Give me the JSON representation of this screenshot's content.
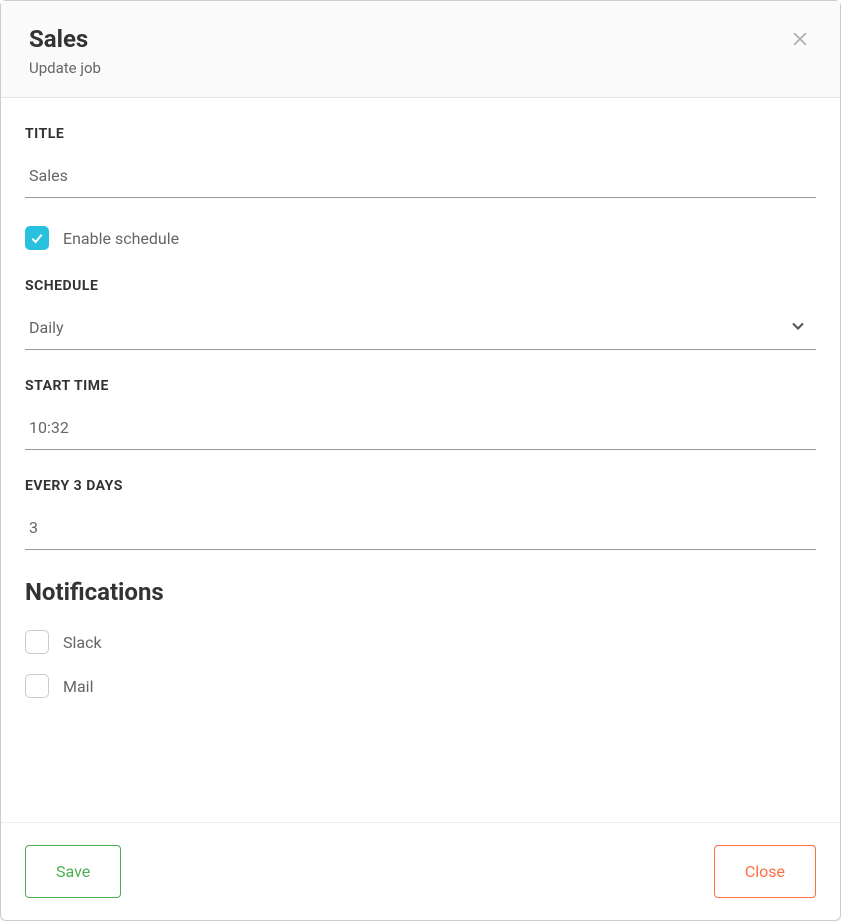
{
  "header": {
    "title": "Sales",
    "subtitle": "Update job"
  },
  "form": {
    "title_label": "TITLE",
    "title_value": "Sales",
    "enable_schedule_label": "Enable schedule",
    "enable_schedule_checked": true,
    "schedule_label": "SCHEDULE",
    "schedule_value": "Daily",
    "start_time_label": "START TIME",
    "start_time_value": "10:32",
    "every_label": "EVERY 3 DAYS",
    "every_value": "3"
  },
  "notifications": {
    "heading": "Notifications",
    "slack_label": "Slack",
    "slack_checked": false,
    "mail_label": "Mail",
    "mail_checked": false
  },
  "footer": {
    "save_label": "Save",
    "close_label": "Close"
  }
}
